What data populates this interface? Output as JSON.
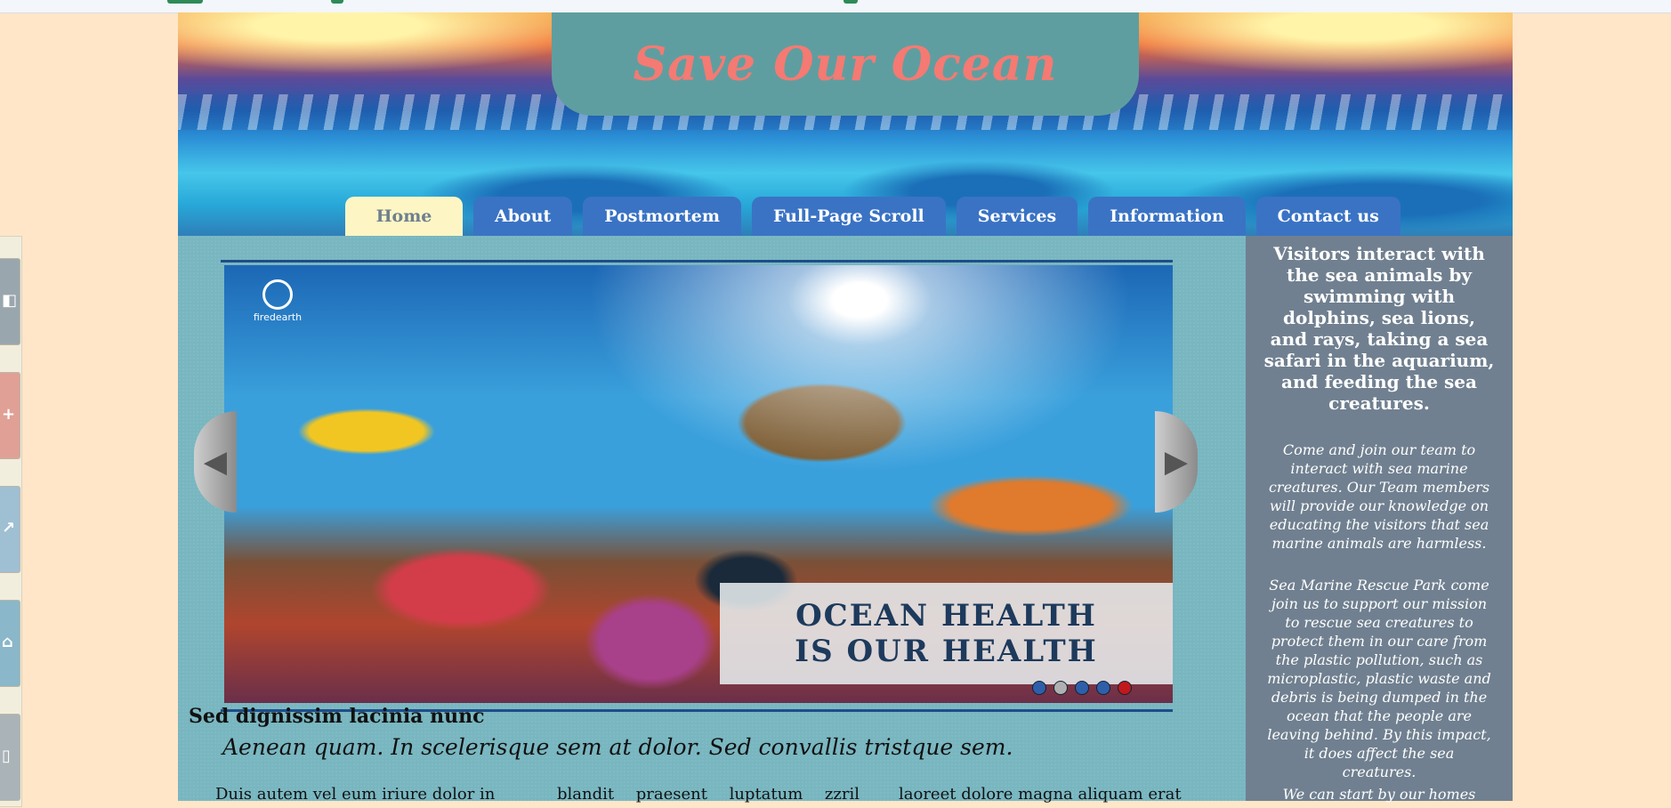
{
  "site": {
    "title": "Save Our Ocean"
  },
  "nav": {
    "items": [
      {
        "label": "Home"
      },
      {
        "label": "About"
      },
      {
        "label": "Postmortem"
      },
      {
        "label": "Full-Page Scroll"
      },
      {
        "label": "Services"
      },
      {
        "label": "Information"
      },
      {
        "label": "Contact us"
      }
    ],
    "active": "Home"
  },
  "slider": {
    "logo_text": "firedearth",
    "banner_line1": "OCEAN HEALTH",
    "banner_line2": "IS OUR HEALTH",
    "dots": 5,
    "active_dot": 2
  },
  "content": {
    "heading": "Sed dignissim lacinia nunc",
    "subheading": "Aenean quam. In scelerisque sem at dolor. Sed convallis tristque sem.",
    "col1": "Duis autem vel eum iriure dolor in",
    "col2": "blandit praesent luptatum zzril delenit",
    "col3": "laoreet dolore magna aliquam erat"
  },
  "sidebar": {
    "intro": "Visitors interact with the sea animals by swimming with dolphins, sea lions, and rays, taking a sea safari in the aquarium, and feeding the sea creatures.",
    "p1": "Come and join our team to interact with sea marine creatures. Our Team members will provide our knowledge on educating the visitors that sea marine animals are harmless.",
    "p2": "Sea Marine Rescue Park come join us to support our mission to rescue sea creatures to protect them in our care from the plastic pollution, such as microplastic, plastic waste and debris is being dumped in the ocean that the people are leaving behind. By this impact, it does affect the sea creatures.",
    "p3": "We can start by our homes"
  },
  "colors": {
    "page_bg": "#ffe6c8",
    "title_box": "#5f9ea0",
    "title_text": "#f47a73",
    "nav_tab": "#3a73c4",
    "nav_active": "#fdf6c4",
    "main_bg": "#78b6c0",
    "sidebar_bg": "#708090"
  },
  "icons": {
    "share_buttons": [
      "share-icon",
      "google-plus-icon",
      "twitter-icon",
      "email-icon",
      "bookmark-icon"
    ],
    "slider_prev": "left-arrow-icon",
    "slider_next": "right-arrow-icon"
  }
}
